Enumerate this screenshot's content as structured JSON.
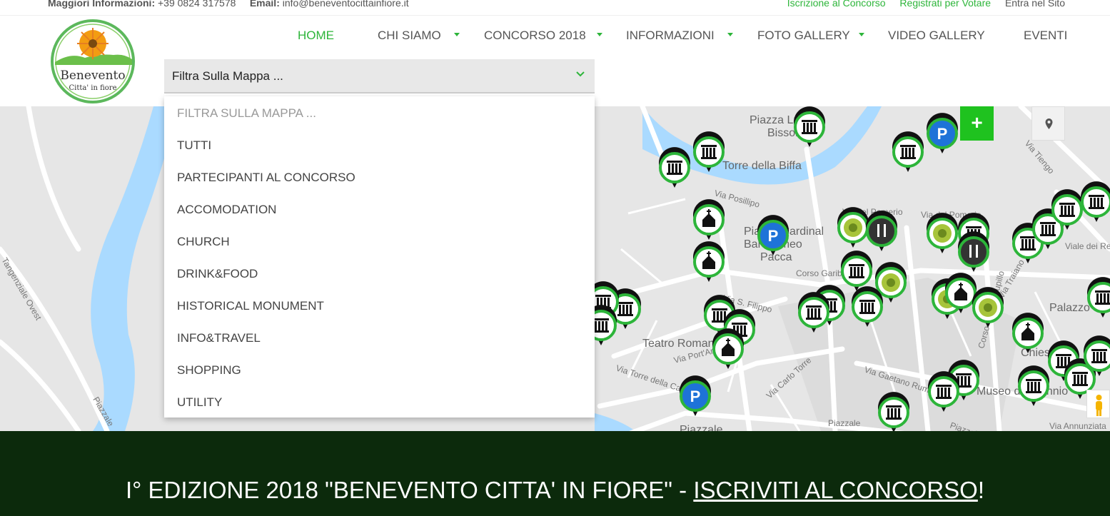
{
  "topbar": {
    "info_label": "Maggiori Informazioni:",
    "phone": "+39 0824 317578",
    "email_label": "Email:",
    "email": "info@beneventocittainfiore.it",
    "links": [
      "Iscrizione al Concorso",
      "Registrati per Votare",
      "Entra nel Sito"
    ]
  },
  "logo": {
    "title": "Benevento",
    "subtitle": "Citta' in fiore"
  },
  "nav": {
    "items": [
      {
        "label": "HOME",
        "active": true
      },
      {
        "label": "CHI SIAMO",
        "dropdown": true
      },
      {
        "label": "CONCORSO 2018",
        "dropdown": true
      },
      {
        "label": "INFORMAZIONI",
        "dropdown": true
      },
      {
        "label": "FOTO GALLERY",
        "dropdown": true
      },
      {
        "label": "VIDEO GALLERY"
      },
      {
        "label": "EVENTI"
      }
    ]
  },
  "filter": {
    "selected": "Filtra Sulla Mappa ...",
    "options": [
      "FILTRA SULLA MAPPA ...",
      "TUTTI",
      "PARTECIPANTI AL CONCORSO",
      "ACCOMODATION",
      "CHURCH",
      "DRINK&FOOD",
      "HISTORICAL MONUMENT",
      "INFO&TRAVEL",
      "SHOPPING",
      "UTILITY"
    ]
  },
  "map": {
    "add_button": "+",
    "labels": [
      "Piazza Lucio",
      "Bissolati",
      "Torre della Biffa",
      "Via Posillipo",
      "Piazza Cardinal",
      "Bartolomeo",
      "Pacca",
      "Corso Garibaldi",
      "Via S. Filippo",
      "Teatro Romano",
      "Via Port'Arsa",
      "Via Torre della Catena",
      "Via Carlo Torre",
      "Via del Pomerio",
      "Via Gaetano Rummo",
      "Palazzo",
      "Chiesa di",
      "Museo del Sannio",
      "Viale dei Rettori",
      "Via Tiengo",
      "Piazzale",
      "Tangenziale Ovest",
      "Via Annunziata",
      "Via Traiano",
      "Corso Vittorio Pupillo"
    ],
    "colors": {
      "pin_green": "#2db53a",
      "pin_dark": "#1a1a1a",
      "parking_blue": "#1e73d8",
      "river": "#a9d8f2"
    }
  },
  "banner": {
    "text": "I° EDIZIONE 2018 \"BENEVENTO CITTA' IN FIORE\" - ",
    "link": "ISCRIVITI AL CONCORSO",
    "suffix": "!"
  }
}
